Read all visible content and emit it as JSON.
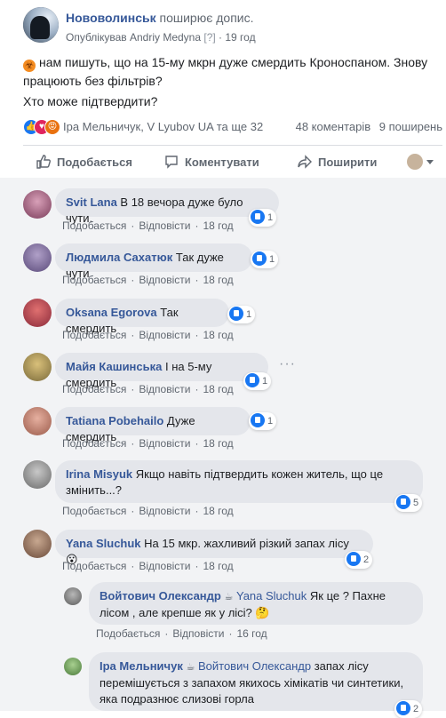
{
  "post": {
    "page_name": "Нововолинськ",
    "shared_text": "поширює допис.",
    "published_by": "Опублікував Andriy Medyna",
    "help": "[?]",
    "time": "· 19 год",
    "text_line1": "нам пишуть, що на 15-му мкрн дуже смердить Кроноспаном. Знову",
    "text_line2": "працюють без фільтрів?",
    "question": "Хто може підтвердити?"
  },
  "reactions": {
    "icons": [
      "like-icon",
      "love-icon",
      "angry-icon"
    ],
    "names": "Іра Мельничук, V Lyubov UA та ще 32",
    "comments_count": "48 коментарів",
    "shares_count": "9 поширень"
  },
  "actions": {
    "like": "Подобається",
    "comment": "Коментувати",
    "share": "Поширити"
  },
  "comment_actions": {
    "like": "Подобається",
    "reply": "Відповісти"
  },
  "comments": [
    {
      "name": "Svit Lana",
      "text": "В 18 вечора дуже було чути.",
      "time": "18 год",
      "likes": "1"
    },
    {
      "name": "Людмила Сахатюк",
      "text": "Так дуже чути",
      "time": "18 год",
      "likes": "1"
    },
    {
      "name": "Oksana Egorova",
      "text": "Так смердить",
      "time": "18 год",
      "likes": "1"
    },
    {
      "name": "Майя Кашинська",
      "text": "І на 5-му смердить",
      "time": "18 год",
      "likes": "1"
    },
    {
      "name": "Tatiana Pobehailo",
      "text": "Дуже смердить",
      "time": "18 год",
      "likes": "1"
    },
    {
      "name": "Irina Misyuk",
      "text_line1": "Якщо навіть підтвердить кожен житель, що це",
      "text_line2": "змінить...?",
      "time": "18 год",
      "likes": "5"
    },
    {
      "name": "Yana Sluchuk",
      "text": "На 15 мкр. жахливий різкий запах лісу",
      "time": "18 год",
      "likes": "2"
    }
  ],
  "replies": [
    {
      "name": "Войтович Олександр",
      "mention": "Yana Sluchuk",
      "text_line1": "Як це ? Пахне",
      "text_line2": "лісом , але крепше як у лісі?",
      "time": "16 год"
    },
    {
      "name": "Іра Мельничук",
      "mention": "Войтович Олександр",
      "text_line1": "запах лісу",
      "text_line2": "перемішується з запахом якихось хімікатів чи синтетики,",
      "text_line3": "яка подразнює слизові горла",
      "likes": "2"
    }
  ],
  "colors": {
    "link": "#365899",
    "secondary": "#606770",
    "bubble": "#e4e6eb",
    "like_blue": "#1877f2"
  }
}
